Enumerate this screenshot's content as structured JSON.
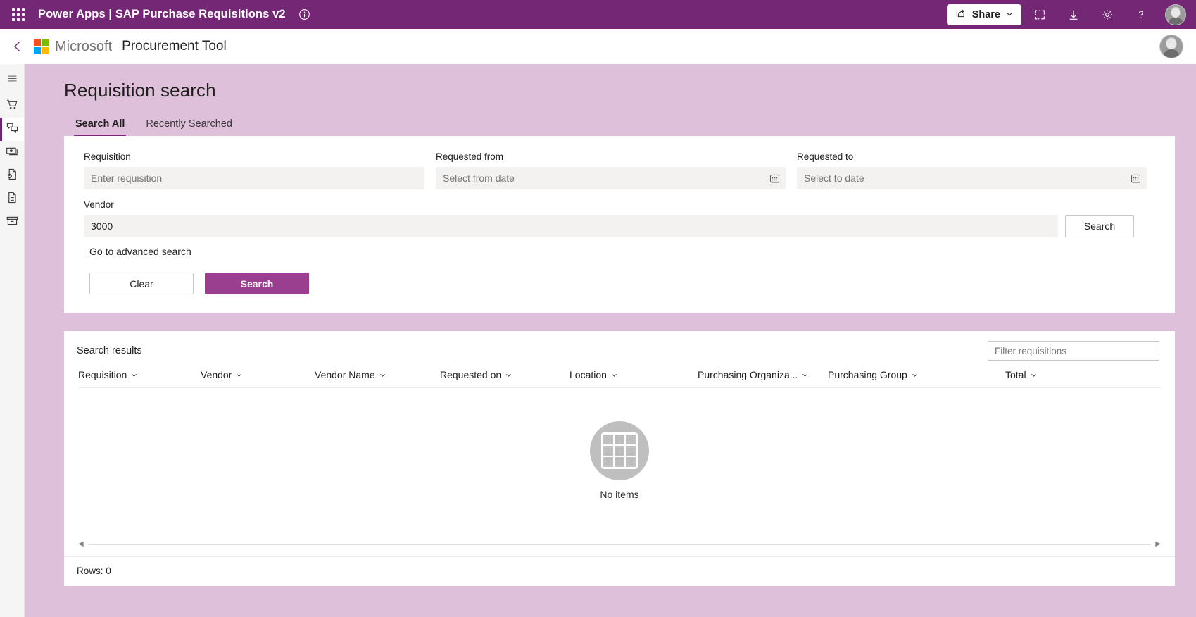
{
  "powerapps_bar": {
    "waffle_icon": "app-launcher-icon",
    "product": "Power Apps",
    "separator": "|",
    "app_title": "SAP Purchase Requisitions v2",
    "title_full": "Power Apps  |  SAP Purchase Requisitions v2",
    "info_icon": "info-icon",
    "share_label": "Share",
    "share_icon": "share-icon",
    "share_chevron": "chevron-down-icon",
    "icons": {
      "fit_screen": "fit-to-screen-icon",
      "download": "download-icon",
      "settings": "gear-icon",
      "help": "help-icon",
      "account": "user-avatar"
    },
    "background": "#742774"
  },
  "app_header": {
    "back_icon": "back-chevron-icon",
    "logo": "microsoft-logo",
    "brand": "Microsoft",
    "app_name": "Procurement Tool",
    "avatar": "user-avatar"
  },
  "rail": {
    "items": [
      {
        "name": "menu-icon",
        "label": "Menu",
        "active": false
      },
      {
        "name": "cart-icon",
        "label": "Shopping cart",
        "active": false
      },
      {
        "name": "feedback-icon",
        "label": "Requisitions",
        "active": true
      },
      {
        "name": "cash-icon",
        "label": "Payments",
        "active": false
      },
      {
        "name": "document-approved-icon",
        "label": "Approvals",
        "active": false
      },
      {
        "name": "document-list-icon",
        "label": "Documents",
        "active": false
      },
      {
        "name": "archive-icon",
        "label": "Archive",
        "active": false
      }
    ]
  },
  "page": {
    "title": "Requisition search",
    "background": "#dfc0da"
  },
  "tabs": [
    {
      "label": "Search All",
      "active": true
    },
    {
      "label": "Recently Searched",
      "active": false
    }
  ],
  "search_form": {
    "fields": {
      "requisition": {
        "label": "Requisition",
        "value": "",
        "placeholder": "Enter requisition"
      },
      "requested_from": {
        "label": "Requested from",
        "value": "",
        "placeholder": "Select from date",
        "icon": "calendar-icon"
      },
      "requested_to": {
        "label": "Requested to",
        "value": "",
        "placeholder": "Select to date",
        "icon": "calendar-icon"
      },
      "vendor": {
        "label": "Vendor",
        "value": "3000",
        "placeholder": ""
      }
    },
    "inline_search_label": "Search",
    "advanced_link": "Go to advanced search",
    "clear_label": "Clear",
    "search_label": "Search",
    "primary_color": "#9a3f8f"
  },
  "results": {
    "title": "Search results",
    "filter_placeholder": "Filter requisitions",
    "columns": [
      {
        "label": "Requisition",
        "sort_icon": "chevron-down-icon"
      },
      {
        "label": "Vendor",
        "sort_icon": "chevron-down-icon"
      },
      {
        "label": "Vendor Name",
        "sort_icon": "chevron-down-icon"
      },
      {
        "label": "Requested on",
        "sort_icon": "chevron-down-icon"
      },
      {
        "label": "Location",
        "sort_icon": "chevron-down-icon"
      },
      {
        "label": "Purchasing Organiza...",
        "sort_icon": "chevron-down-icon"
      },
      {
        "label": "Purchasing Group",
        "sort_icon": "chevron-down-icon"
      },
      {
        "label": "Total",
        "sort_icon": "chevron-down-icon"
      }
    ],
    "rows": [],
    "empty_icon": "empty-grid-icon",
    "empty_text": "No items",
    "scroll_left_icon": "triangle-left-icon",
    "scroll_right_icon": "triangle-right-icon",
    "rows_count": "Rows: 0"
  }
}
